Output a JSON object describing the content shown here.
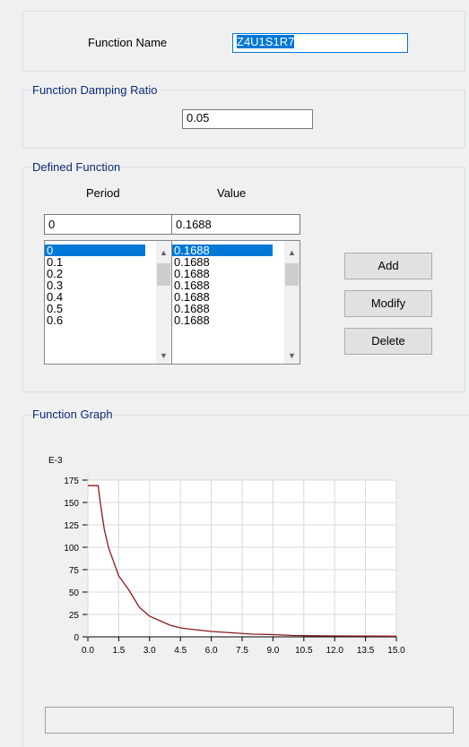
{
  "function_name": {
    "label": "Function Name",
    "value": "Z4U1S1R7"
  },
  "damping": {
    "legend": "Function Damping Ratio",
    "value": "0.05"
  },
  "defined": {
    "legend": "Defined Function",
    "period_header": "Period",
    "value_header": "Value",
    "period_input": "0",
    "value_input": "0.1688",
    "periods": [
      "0",
      "0.1",
      "0.2",
      "0.3",
      "0.4",
      "0.5",
      "0.6"
    ],
    "values": [
      "0.1688",
      "0.1688",
      "0.1688",
      "0.1688",
      "0.1688",
      "0.1688",
      "0.1688"
    ],
    "add_label": "Add",
    "modify_label": "Modify",
    "delete_label": "Delete"
  },
  "graph": {
    "legend": "Function Graph"
  },
  "chart_data": {
    "type": "line",
    "title": "",
    "xlabel": "",
    "ylabel": "",
    "yunit_label": "E-3",
    "xlim": [
      0,
      15.0
    ],
    "ylim": [
      0,
      175
    ],
    "xticks": [
      "0.0",
      "1.5",
      "3.0",
      "4.5",
      "6.0",
      "7.5",
      "9.0",
      "10.5",
      "12.0",
      "13.5",
      "15.0"
    ],
    "yticks": [
      "0",
      "25",
      "50",
      "75",
      "100",
      "125",
      "150",
      "175"
    ],
    "grid": true,
    "color": "#8b1a1a",
    "x": [
      0,
      0.5,
      0.6,
      0.8,
      1.0,
      1.5,
      2.0,
      2.5,
      3.0,
      3.5,
      4.0,
      4.5,
      5.0,
      6.0,
      7.0,
      8.0,
      9.0,
      10.0,
      11.0,
      12.0,
      13.0,
      14.0,
      15.0
    ],
    "y": [
      168.8,
      168.8,
      150,
      120,
      100,
      68,
      52,
      33,
      23,
      18,
      13,
      10,
      8.5,
      6,
      4.5,
      3,
      2.5,
      1.5,
      1.2,
      1.0,
      0.9,
      0.8,
      0.7
    ]
  }
}
